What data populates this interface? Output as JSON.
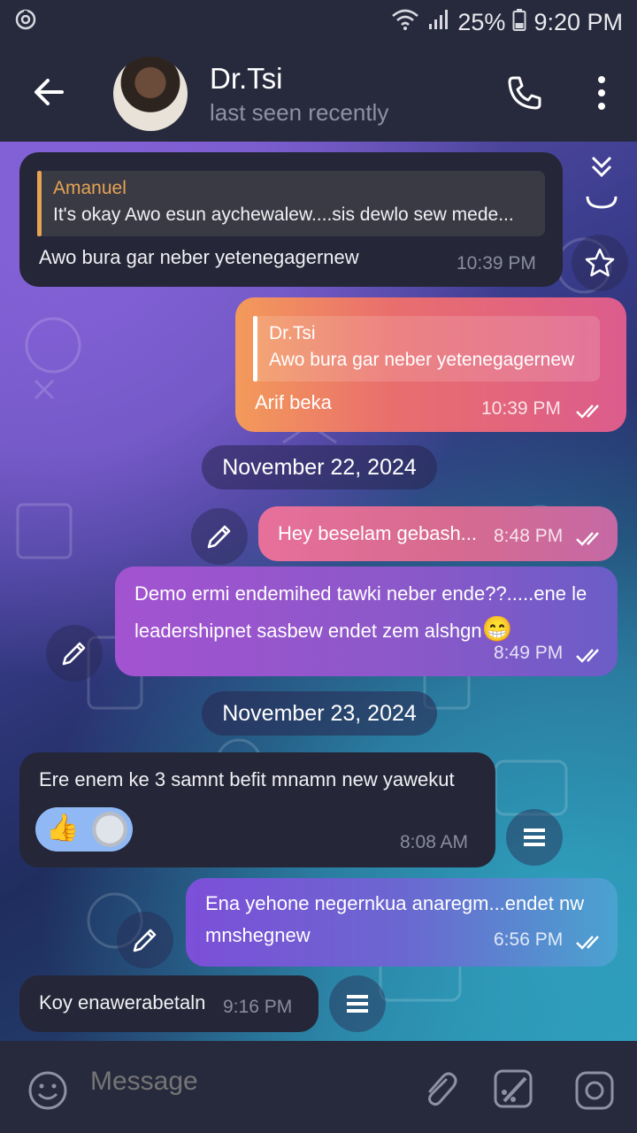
{
  "status_bar": {
    "battery": "25%",
    "time": "9:20 PM"
  },
  "header": {
    "name": "Dr.Tsi",
    "status": "last seen recently"
  },
  "messages": [
    {
      "reply_name": "Amanuel",
      "reply_text": "It's okay Awo esun aychewalew....sis dewlo sew mede...",
      "text": "Awo bura gar neber yetenegagernew",
      "time": "10:39 PM"
    },
    {
      "reply_name": "Dr.Tsi",
      "reply_text": "Awo bura gar neber yetenegagernew",
      "text": "Arif beka",
      "time": "10:39 PM"
    },
    {
      "text": "Hey beselam gebash...",
      "time": "8:48 PM"
    },
    {
      "text_line1": "Demo ermi endemihed tawki neber ende??.....ene le",
      "text_line2": "leadershipnet sasbew endet zem alshgn",
      "emoji": "😁",
      "time": "8:49 PM"
    },
    {
      "text": "Ere enem ke 3 samnt befit mnamn new yawekut",
      "reaction": "👍",
      "time": "8:08 AM"
    },
    {
      "text_line1": "Ena yehone negernkua anaregm...endet nw",
      "text_line2": "mnshegnew",
      "time": "6:56 PM"
    },
    {
      "text": "Koy enawerabetaln",
      "time": "9:16 PM"
    }
  ],
  "dates": [
    "November 22, 2024",
    "November 23, 2024"
  ],
  "composer": {
    "placeholder": "Message"
  }
}
